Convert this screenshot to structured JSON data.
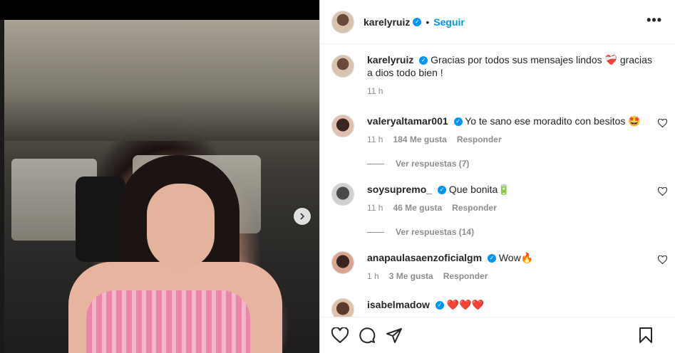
{
  "post": {
    "author": "karelyruiz",
    "follow_label": "Seguir",
    "dot": "•",
    "more_label": "•••"
  },
  "caption": {
    "username": "karelyruiz",
    "text": "Gracias por todos sus mensajes lindos ❤‍🩹 gracias a dios todo bien !",
    "time": "11 h"
  },
  "comments": [
    {
      "username": "valeryaltamar001",
      "text": "Yo te sano ese moradito con besitos 🤩",
      "time": "11 h",
      "likes": "184 Me gusta",
      "reply_label": "Responder",
      "view_replies": "Ver respuestas (7)"
    },
    {
      "username": "soysupremo_",
      "text": "Que bonita🔋",
      "time": "11 h",
      "likes": "46 Me gusta",
      "reply_label": "Responder",
      "view_replies": "Ver respuestas (14)"
    },
    {
      "username": "anapaulasaenzoficialgm",
      "text": "Wow🔥",
      "time": "1 h",
      "likes": "3 Me gusta",
      "reply_label": "Responder"
    },
    {
      "username": "isabelmadow",
      "text": "❤️❤️❤️"
    }
  ],
  "icons": {
    "heart": "heart-icon",
    "comment": "comment-icon",
    "share": "share-icon",
    "save": "bookmark-icon",
    "next": "chevron-right-icon",
    "verified": "verified-badge-icon"
  },
  "colors": {
    "accent": "#0095f6",
    "text": "#262626",
    "muted": "#8e8e8e"
  }
}
